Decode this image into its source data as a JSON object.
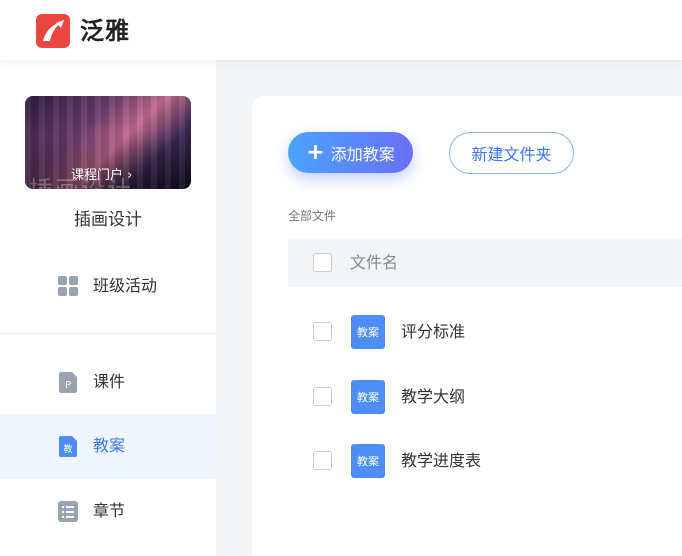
{
  "header": {
    "brand": "泛雅"
  },
  "sidebar": {
    "cover": {
      "portal_label": "课程门户",
      "portal_chevron": "›"
    },
    "course_name": "插画设计",
    "items": [
      {
        "label": "班级活动",
        "icon": "grid-icon"
      },
      {
        "label": "课件",
        "icon": "ppt-file-icon",
        "glyph": "P"
      },
      {
        "label": "教案",
        "icon": "lesson-plan-file-icon",
        "glyph": "教",
        "active": true
      },
      {
        "label": "章节",
        "icon": "list-icon"
      }
    ]
  },
  "main": {
    "add_button": {
      "plus": "+",
      "label": "添加教案"
    },
    "new_folder_button": {
      "label": "新建文件夹"
    },
    "breadcrumb": "全部文件",
    "table": {
      "column_name": "文件名",
      "rows": [
        {
          "icon_label": "教案",
          "name": "评分标准"
        },
        {
          "icon_label": "教案",
          "name": "教学大纲"
        },
        {
          "icon_label": "教案",
          "name": "教学进度表"
        }
      ]
    }
  },
  "colors": {
    "brand_red": "#e8473f",
    "accent_blue": "#3f78e6",
    "file_icon_blue": "#4d8df5"
  }
}
